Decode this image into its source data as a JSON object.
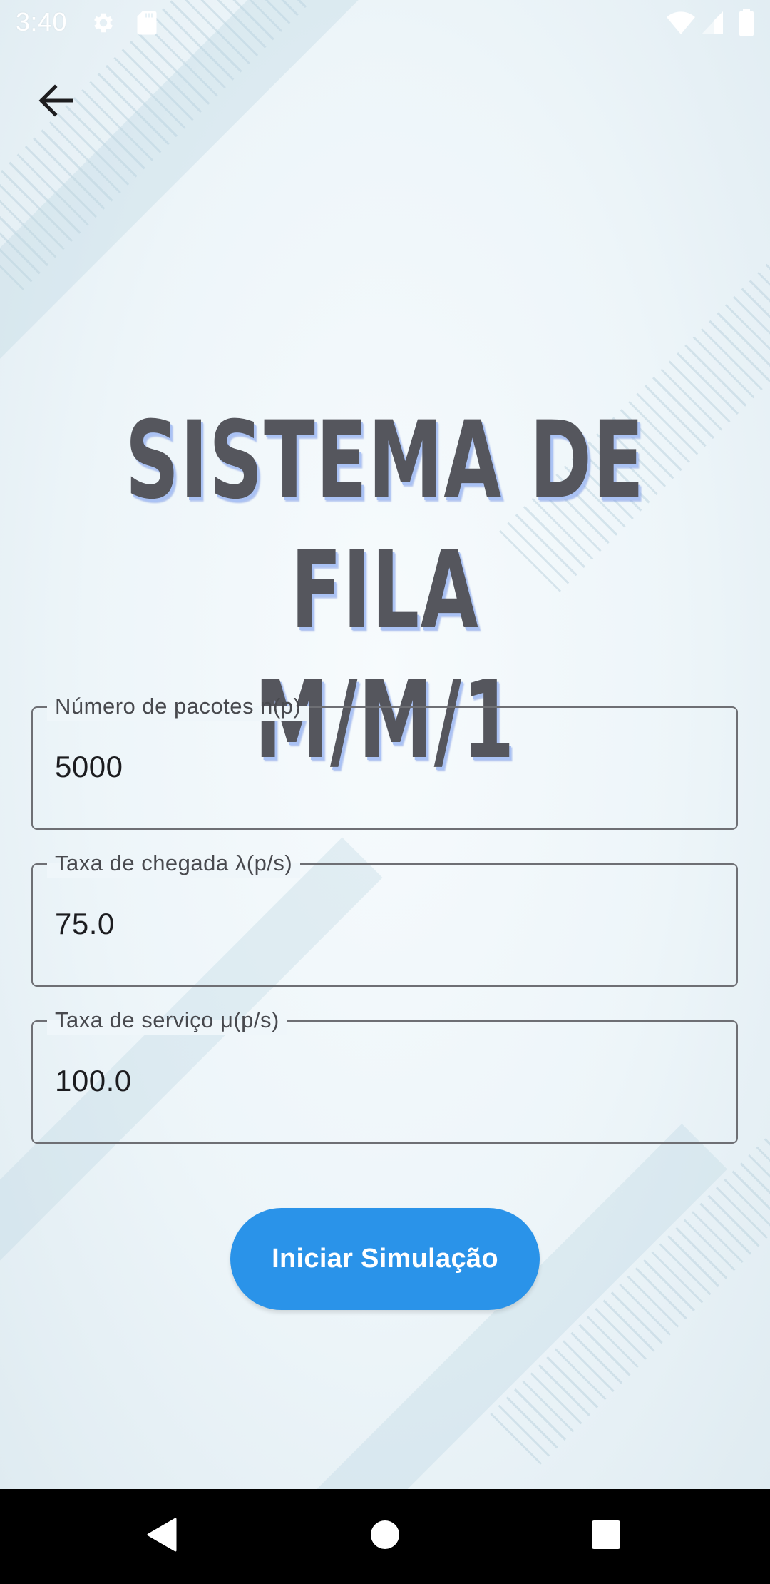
{
  "status_bar": {
    "time": "3:40",
    "icons": [
      "settings-icon",
      "sd-card-icon",
      "wifi-icon",
      "cellular-signal-icon",
      "battery-icon"
    ]
  },
  "app_bar": {
    "back_icon": "arrow-back-icon"
  },
  "title": {
    "line1": "SISTEMA DE FILA",
    "line2": "M/M/1"
  },
  "form": {
    "fields": [
      {
        "label": "Número de pacotes n(p)",
        "value": "5000"
      },
      {
        "label": "Taxa de chegada λ(p/s)",
        "value": "75.0"
      },
      {
        "label": "Taxa de serviço μ(p/s)",
        "value": "100.0"
      }
    ],
    "submit_label": "Iniciar Simulação"
  },
  "nav_bar": {
    "icons": [
      "back-triangle-icon",
      "home-circle-icon",
      "recents-square-icon"
    ]
  },
  "colors": {
    "accent": "#2a93e9",
    "title_text": "#55565d",
    "title_shadow": "#aac2f4",
    "field_border": "#6e6f74",
    "nav_background": "#000000"
  }
}
